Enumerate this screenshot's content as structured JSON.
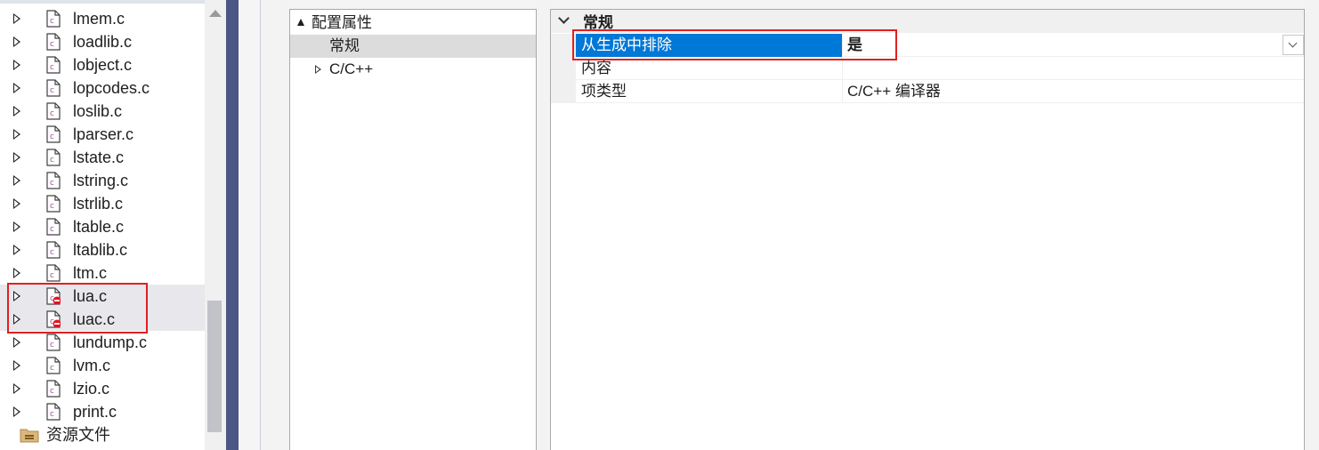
{
  "explorer": {
    "files": [
      {
        "name": "lmem.c",
        "excluded": false
      },
      {
        "name": "loadlib.c",
        "excluded": false
      },
      {
        "name": "lobject.c",
        "excluded": false
      },
      {
        "name": "lopcodes.c",
        "excluded": false
      },
      {
        "name": "loslib.c",
        "excluded": false
      },
      {
        "name": "lparser.c",
        "excluded": false
      },
      {
        "name": "lstate.c",
        "excluded": false
      },
      {
        "name": "lstring.c",
        "excluded": false
      },
      {
        "name": "lstrlib.c",
        "excluded": false
      },
      {
        "name": "ltable.c",
        "excluded": false
      },
      {
        "name": "ltablib.c",
        "excluded": false
      },
      {
        "name": "ltm.c",
        "excluded": false
      },
      {
        "name": "lua.c",
        "excluded": true
      },
      {
        "name": "luac.c",
        "excluded": true
      },
      {
        "name": "lundump.c",
        "excluded": false
      },
      {
        "name": "lvm.c",
        "excluded": false
      },
      {
        "name": "lzio.c",
        "excluded": false
      },
      {
        "name": "print.c",
        "excluded": false
      }
    ],
    "folder": {
      "name": "资源文件",
      "icon": "resource-folder-icon"
    }
  },
  "property_tree": {
    "root": {
      "label": "配置属性"
    },
    "items": [
      {
        "label": "常规",
        "selected": true
      },
      {
        "label": "C/C++",
        "selected": false
      }
    ]
  },
  "property_grid": {
    "category": "常规",
    "rows": [
      {
        "name": "从生成中排除",
        "value": "是",
        "selected": true,
        "bold": true,
        "has_dropdown": true
      },
      {
        "name": "内容",
        "value": "",
        "selected": false,
        "bold": false,
        "has_dropdown": false
      },
      {
        "name": "项类型",
        "value": "C/C++ 编译器",
        "selected": false,
        "bold": false,
        "has_dropdown": false
      }
    ]
  },
  "colors": {
    "accent": "#0078d7",
    "annotation": "#e02020",
    "splitter": "#4a5683",
    "file_icon_letter": "#9b4f96",
    "excluded_badge": "#e81123"
  }
}
